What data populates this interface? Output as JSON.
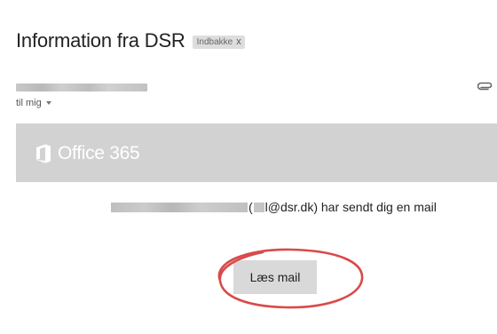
{
  "email": {
    "subject": "Information fra DSR",
    "label": "Indbakke",
    "label_remove": "x",
    "recipient_text": "til mig"
  },
  "banner": {
    "logo_text": "Office 365"
  },
  "body": {
    "open_paren": "(",
    "email_suffix": "l@dsr.dk) har sendt dig en mail",
    "button_label": "Læs mail"
  },
  "icons": {
    "attachment": "paperclip-icon",
    "recipient_menu": "chevron-down-icon",
    "office": "office-logo-icon"
  },
  "colors": {
    "banner": "#d2d2d2",
    "button": "#d9d9d9",
    "highlight": "#d94a4a"
  }
}
